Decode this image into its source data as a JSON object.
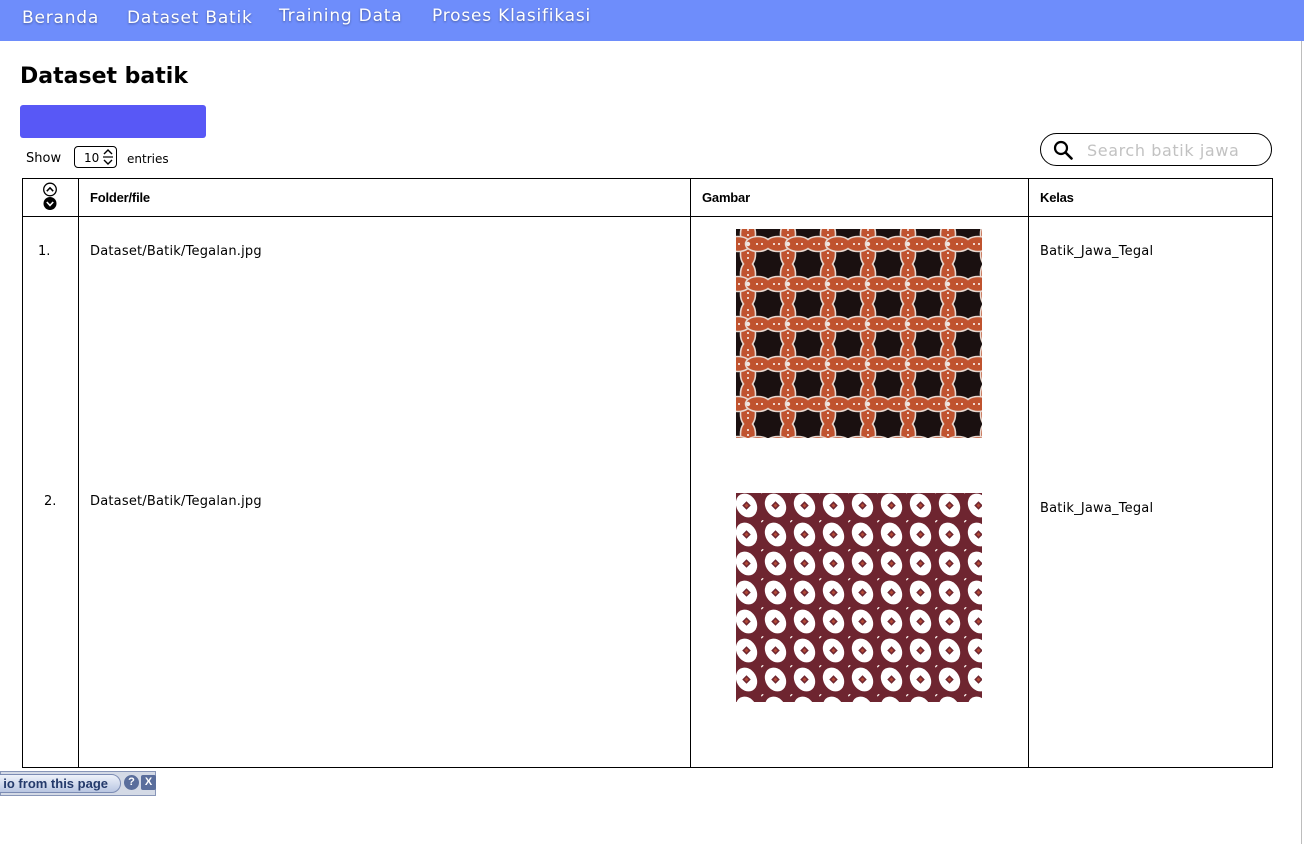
{
  "nav": {
    "items": [
      {
        "label": "Beranda"
      },
      {
        "label": "Dataset Batik"
      },
      {
        "label": "Training Data"
      },
      {
        "label": "Proses Klasifikasi"
      }
    ]
  },
  "page": {
    "title": "Dataset batik"
  },
  "toolbar": {
    "add_button_label": ""
  },
  "entries": {
    "show_label": "Show",
    "value": "10",
    "suffix": "entries"
  },
  "search": {
    "placeholder": "Search batik jawa",
    "value": ""
  },
  "table": {
    "columns": [
      "Folder/file",
      "Gambar",
      "Kelas"
    ],
    "rows": [
      {
        "no": "1.",
        "file": "Dataset/Batik/Tegalan.jpg",
        "image": "kawung-orange",
        "kelas": "Batik_Jawa_Tegal"
      },
      {
        "no": "2.",
        "file": "Dataset/Batik/Tegalan.jpg",
        "image": "kawung-maroon",
        "kelas": "Batik_Jawa_Tegal"
      }
    ]
  },
  "helper_toolbar": {
    "label": "io from this page",
    "help_symbol": "?",
    "close_symbol": "X"
  },
  "colors": {
    "navbar": "#6e8dfb",
    "primary_button": "#5858f6",
    "batik1_bg": "#1a1010",
    "batik1_motif": "#c0532f",
    "batik2_bg": "#6e2530",
    "batik2_motif": "#ffffff"
  }
}
